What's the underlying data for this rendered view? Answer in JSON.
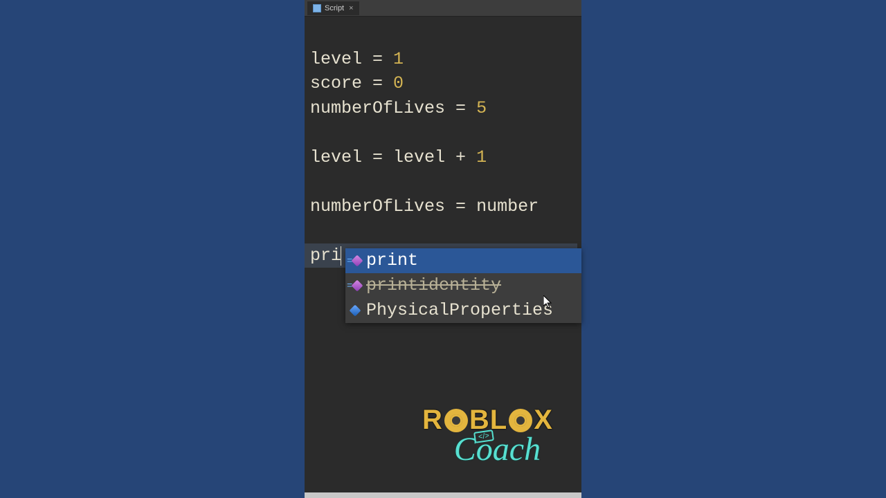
{
  "tab": {
    "label": "Script"
  },
  "code": {
    "line1": {
      "a": "level",
      "op": " = ",
      "val": "1"
    },
    "line2": {
      "a": "score",
      "op": " = ",
      "val": "0"
    },
    "line3": {
      "a": "numberOfLives",
      "op": " = ",
      "val": "5"
    },
    "line5": {
      "a": "level",
      "op": " = ",
      "b": "level",
      "op2": " + ",
      "val": "1"
    },
    "line7": {
      "a": "numberOfLives",
      "op": " = ",
      "b": "number"
    },
    "line9": {
      "typed": "pri"
    }
  },
  "autocomplete": {
    "items": [
      {
        "label": "print",
        "kind": "func",
        "selected": true,
        "deprecated": false
      },
      {
        "label": "printidentity",
        "kind": "func",
        "selected": false,
        "deprecated": true
      },
      {
        "label": "PhysicalProperties",
        "kind": "class",
        "selected": false,
        "deprecated": false
      }
    ]
  },
  "brand": {
    "top": "ROBLOX",
    "tag": "</>",
    "bottom": "Coach"
  }
}
